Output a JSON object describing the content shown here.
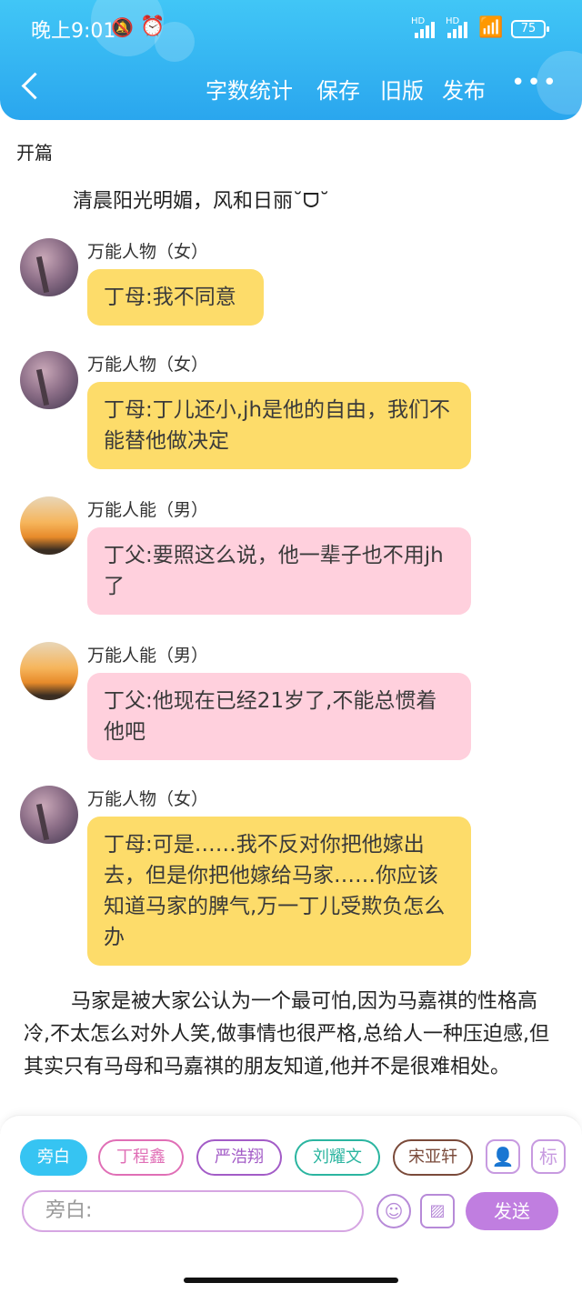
{
  "status_bar": {
    "time": "晚上9:01",
    "hd1": "HD",
    "hd2": "HD",
    "battery": "75"
  },
  "toolbar": {
    "word_count": "字数统计",
    "save": "保存",
    "old_version": "旧版",
    "publish": "发布",
    "more": "•••"
  },
  "chapter": {
    "title": "开篇",
    "opening": "清晨阳光明媚，风和日丽˘ᗜ˘"
  },
  "messages": [
    {
      "speaker": "万能人物（女）",
      "text": "丁母:我不同意",
      "color": "#fddc6a"
    },
    {
      "speaker": "万能人物（女）",
      "text": "丁母:丁儿还小,jh是他的自由，我们不能替他做决定",
      "color": "#fddc6a"
    },
    {
      "speaker": "万能人能（男）",
      "text": "丁父:要照这么说，他一辈子也不用jh了",
      "color": "#ffd0dd"
    },
    {
      "speaker": "万能人能（男）",
      "text": "丁父:他现在已经21岁了,不能总惯着他吧",
      "color": "#ffd0dd"
    },
    {
      "speaker": "万能人物（女）",
      "text": "丁母:可是……我不反对你把他嫁出去，但是你把他嫁给马家……你应该知道马家的脾气,万一丁儿受欺负怎么办",
      "color": "#fddc6a"
    }
  ],
  "narration": "马家是被大家公认为一个最可怕,因为马嘉祺的性格高冷,不太怎么对外人笑,做事情也很严格,总给人一种压迫感,但其实只有马母和马嘉祺的朋友知道,他并不是很难相处。",
  "composer": {
    "roles": [
      "旁白",
      "丁程鑫",
      "严浩翔",
      "刘耀文",
      "宋亚轩"
    ],
    "role_colors": [
      "#36c4f2",
      "#e06fb6",
      "#a35cc7",
      "#2bb5a0",
      "#7a4a3a"
    ],
    "tag_label": "标",
    "input_placeholder": "旁白:",
    "send_label": "发送"
  }
}
